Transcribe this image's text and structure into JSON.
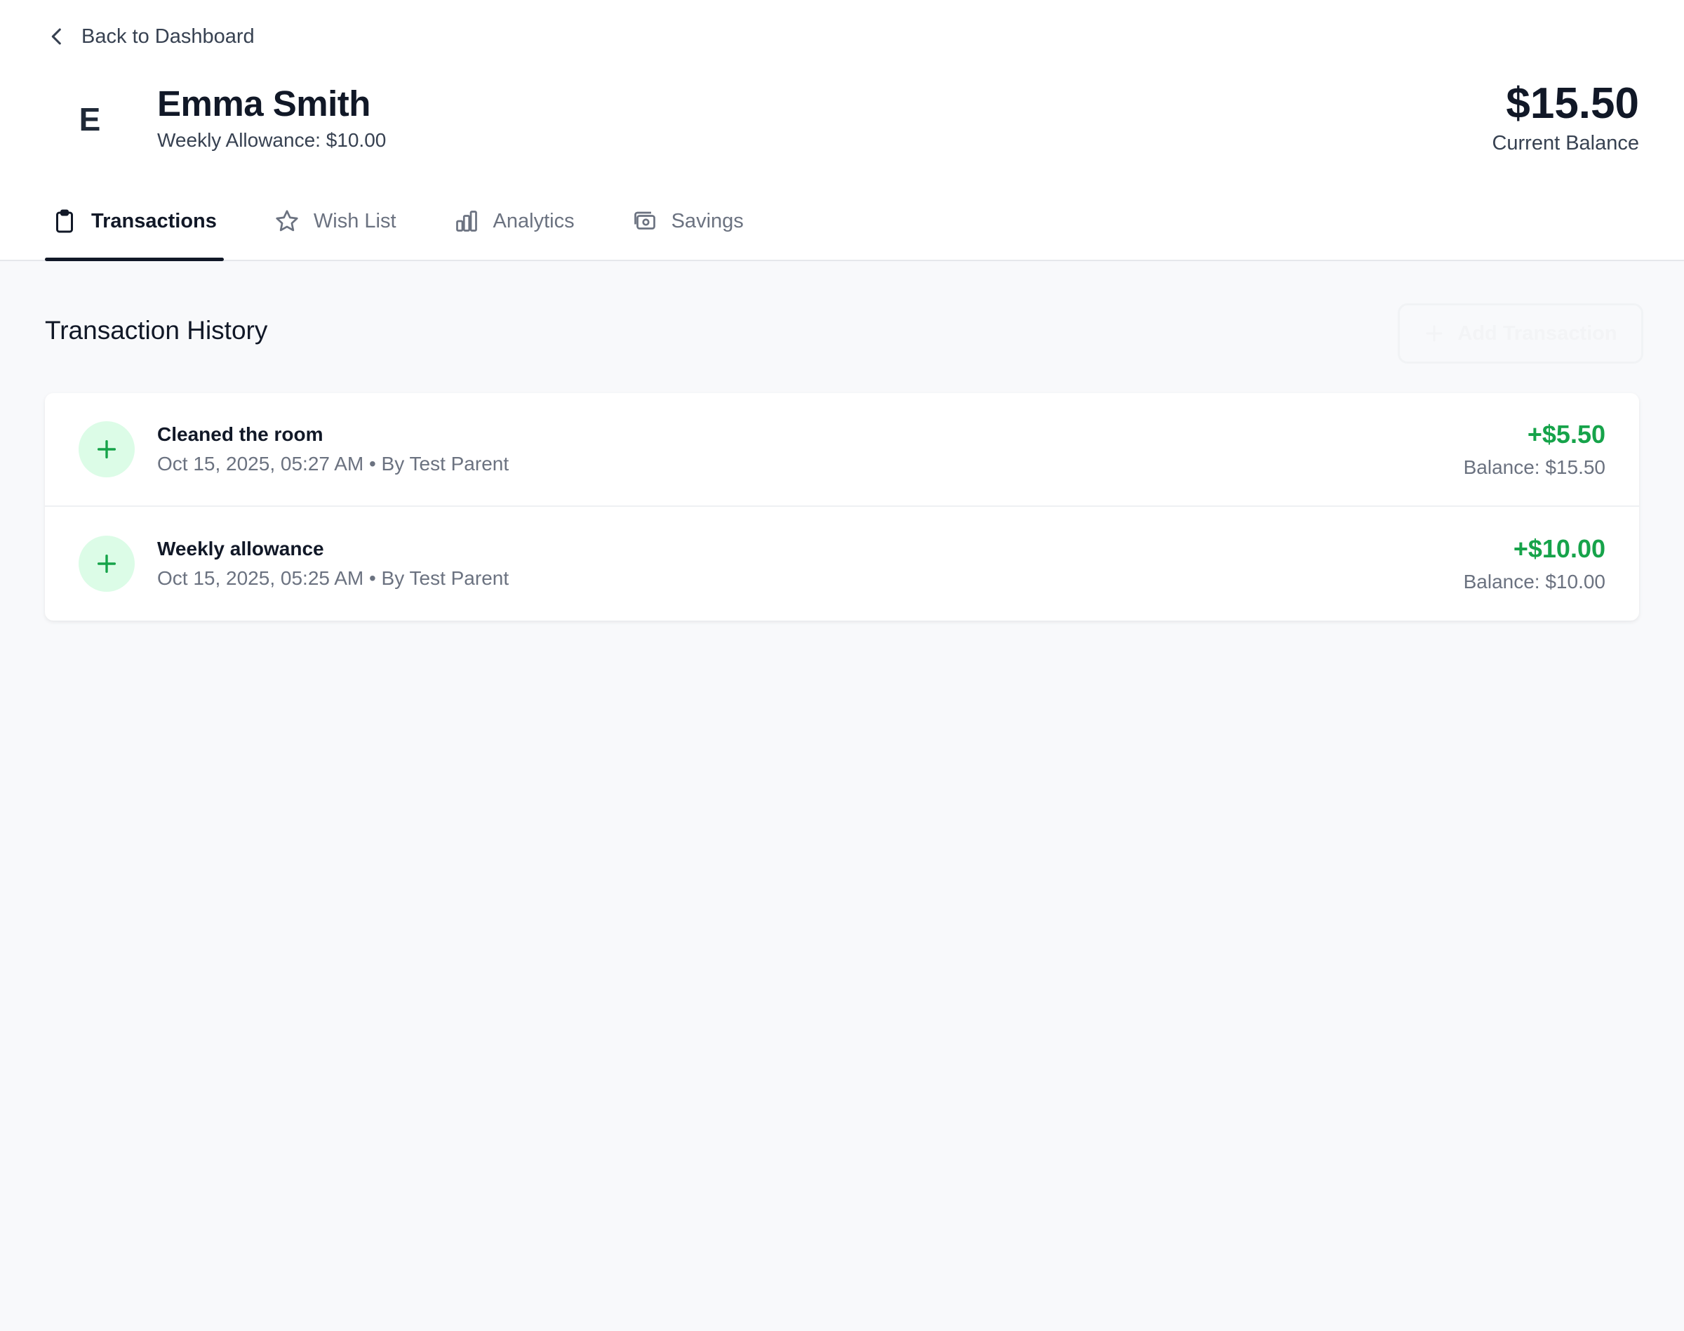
{
  "nav": {
    "back_label": "Back to Dashboard"
  },
  "profile": {
    "initial": "E",
    "name": "Emma Smith",
    "allowance": "Weekly Allowance: $10.00",
    "balance_amount": "$15.50",
    "balance_label": "Current Balance"
  },
  "tabs": [
    {
      "label": "Transactions",
      "icon": "clipboard-icon",
      "active": true
    },
    {
      "label": "Wish List",
      "icon": "star-icon",
      "active": false
    },
    {
      "label": "Analytics",
      "icon": "bar-chart-icon",
      "active": false
    },
    {
      "label": "Savings",
      "icon": "piggy-bank-icon",
      "active": false
    }
  ],
  "section": {
    "title": "Transaction History",
    "add_label": "Add Transaction"
  },
  "transactions": [
    {
      "title": "Cleaned the room",
      "meta": "Oct 15, 2025, 05:27 AM • By Test Parent",
      "amount": "+$5.50",
      "balance": "Balance: $15.50"
    },
    {
      "title": "Weekly allowance",
      "meta": "Oct 15, 2025, 05:25 AM • By Test Parent",
      "amount": "+$10.00",
      "balance": "Balance: $10.00"
    }
  ],
  "colors": {
    "accent": "#111827",
    "positive": "#16a34a",
    "positive_bg": "#dcfce7"
  }
}
